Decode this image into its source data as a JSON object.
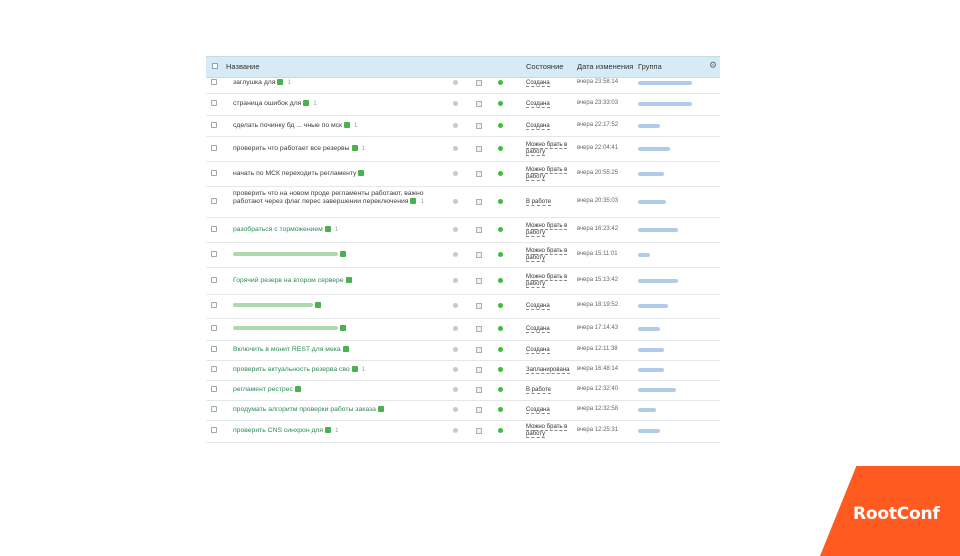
{
  "header": {
    "name": "Название",
    "state": "Состояние",
    "date": "Дата изменения",
    "group": "Группа"
  },
  "rows": [
    {
      "title": "заглушка для",
      "green": false,
      "count": "1",
      "state": "Создана",
      "date": "вчера 23:58:14"
    },
    {
      "title": "страница ошибок для",
      "green": false,
      "count": "1",
      "state": "Создана",
      "date": "вчера 23:33:03"
    },
    {
      "title": "сделать починку бд ... чные по мск",
      "green": false,
      "count": "1",
      "state": "Создана",
      "date": "вчера 22:17:52"
    },
    {
      "title": "проверить что работает все резервы",
      "green": false,
      "count": "1",
      "state": "Можно брать в работу",
      "date": "вчера 22:04:41"
    },
    {
      "title": "начать по МСК переходить регламенту",
      "green": false,
      "count": "",
      "state": "Можно брать в работу",
      "date": "вчера 20:55:25"
    },
    {
      "title": "проверить что на новом проде регламенты работают, важно работают через флаг перес завершении переключения",
      "green": false,
      "count": "1",
      "state": "В работе",
      "date": "вчера 20:35:03"
    },
    {
      "title": "разобраться с торможением",
      "green": true,
      "count": "1",
      "state": "Можно брать в работу",
      "date": "вчера 16:23:42"
    },
    {
      "title": "",
      "green": true,
      "count": "",
      "state": "Можно брать в работу",
      "date": "вчера 15:11:01"
    },
    {
      "title": "Горячий резерв на втором сервере",
      "green": true,
      "count": "",
      "state": "Можно брать в работу",
      "date": "вчера 15:13:42"
    },
    {
      "title": "",
      "green": true,
      "count": "",
      "state": "Создана",
      "date": "вчера 18:19:52"
    },
    {
      "title": "",
      "green": true,
      "count": "",
      "state": "Создана",
      "date": "вчера 17:14:43"
    },
    {
      "title": "Включить в монит REST для мека",
      "green": true,
      "count": "",
      "state": "Создана",
      "date": "вчера 12:11:38"
    },
    {
      "title": "проверить актуальность резерва сво",
      "green": true,
      "count": "1",
      "state": "Запланирована",
      "date": "вчера 16:48:14"
    },
    {
      "title": "регламент рестрес",
      "green": true,
      "count": "",
      "state": "В работе",
      "date": "вчера 12:32:40"
    },
    {
      "title": "продумать алгоритм проверки работы заказа",
      "green": true,
      "count": "",
      "state": "Создана",
      "date": "вчера 12:32:58"
    },
    {
      "title": "проверить CNS синхрон для",
      "green": true,
      "count": "1",
      "state": "Можно брать в работу",
      "date": "вчера 12:25:31"
    }
  ],
  "brand": {
    "logo_text": "RootConf",
    "color": "#ff5a1f"
  }
}
